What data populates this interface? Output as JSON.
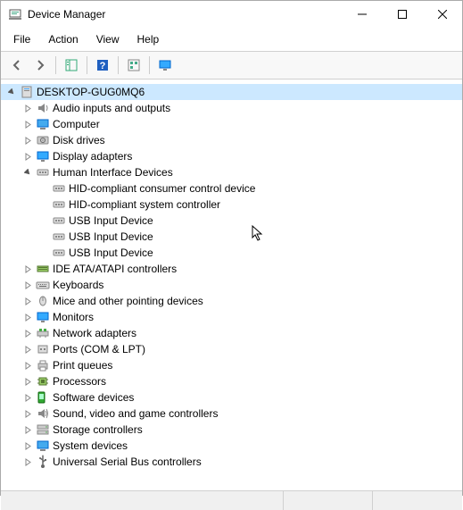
{
  "window": {
    "title": "Device Manager"
  },
  "menu": {
    "file": "File",
    "action": "Action",
    "view": "View",
    "help": "Help"
  },
  "tree": {
    "root": "DESKTOP-GUG0MQ6",
    "categories": [
      {
        "label": "Audio inputs and outputs",
        "icon": "speaker",
        "expanded": false
      },
      {
        "label": "Computer",
        "icon": "computer",
        "expanded": false
      },
      {
        "label": "Disk drives",
        "icon": "disk",
        "expanded": false
      },
      {
        "label": "Display adapters",
        "icon": "display",
        "expanded": false
      },
      {
        "label": "Human Interface Devices",
        "icon": "hid",
        "expanded": true,
        "children": [
          {
            "label": "HID-compliant consumer control device",
            "icon": "hid"
          },
          {
            "label": "HID-compliant system controller",
            "icon": "hid"
          },
          {
            "label": "USB Input Device",
            "icon": "hid"
          },
          {
            "label": "USB Input Device",
            "icon": "hid"
          },
          {
            "label": "USB Input Device",
            "icon": "hid"
          }
        ]
      },
      {
        "label": "IDE ATA/ATAPI controllers",
        "icon": "ide",
        "expanded": false
      },
      {
        "label": "Keyboards",
        "icon": "keyboard",
        "expanded": false
      },
      {
        "label": "Mice and other pointing devices",
        "icon": "mouse",
        "expanded": false
      },
      {
        "label": "Monitors",
        "icon": "monitor",
        "expanded": false
      },
      {
        "label": "Network adapters",
        "icon": "network",
        "expanded": false
      },
      {
        "label": "Ports (COM & LPT)",
        "icon": "port",
        "expanded": false
      },
      {
        "label": "Print queues",
        "icon": "printer",
        "expanded": false
      },
      {
        "label": "Processors",
        "icon": "cpu",
        "expanded": false
      },
      {
        "label": "Software devices",
        "icon": "software",
        "expanded": false
      },
      {
        "label": "Sound, video and game controllers",
        "icon": "sound",
        "expanded": false
      },
      {
        "label": "Storage controllers",
        "icon": "storage",
        "expanded": false
      },
      {
        "label": "System devices",
        "icon": "system",
        "expanded": false
      },
      {
        "label": "Universal Serial Bus controllers",
        "icon": "usb",
        "expanded": false
      }
    ]
  }
}
